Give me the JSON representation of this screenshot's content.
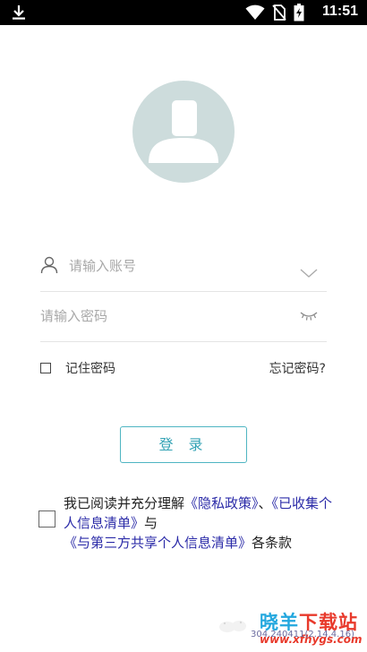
{
  "status_bar": {
    "time": "11:51"
  },
  "login": {
    "account_placeholder": "请输入账号",
    "password_placeholder": "请输入密码",
    "remember_label": "记住密码",
    "forgot_label": "忘记密码?",
    "login_button": "登 录"
  },
  "agreement": {
    "prefix": "我已阅读并充分理解",
    "link1": "《隐私政策》",
    "sep": "、",
    "link2": "《已收集个人信息清单》",
    "mid": "与",
    "link3": "《与第三方共享个人信息清单》",
    "suffix": "各条款"
  },
  "footer": {
    "version": "304.240411(2.14.4.16)",
    "watermark_site_part1": "晓羊",
    "watermark_site_part2": "下载站",
    "watermark_url": "www.xfhygs.com"
  }
}
